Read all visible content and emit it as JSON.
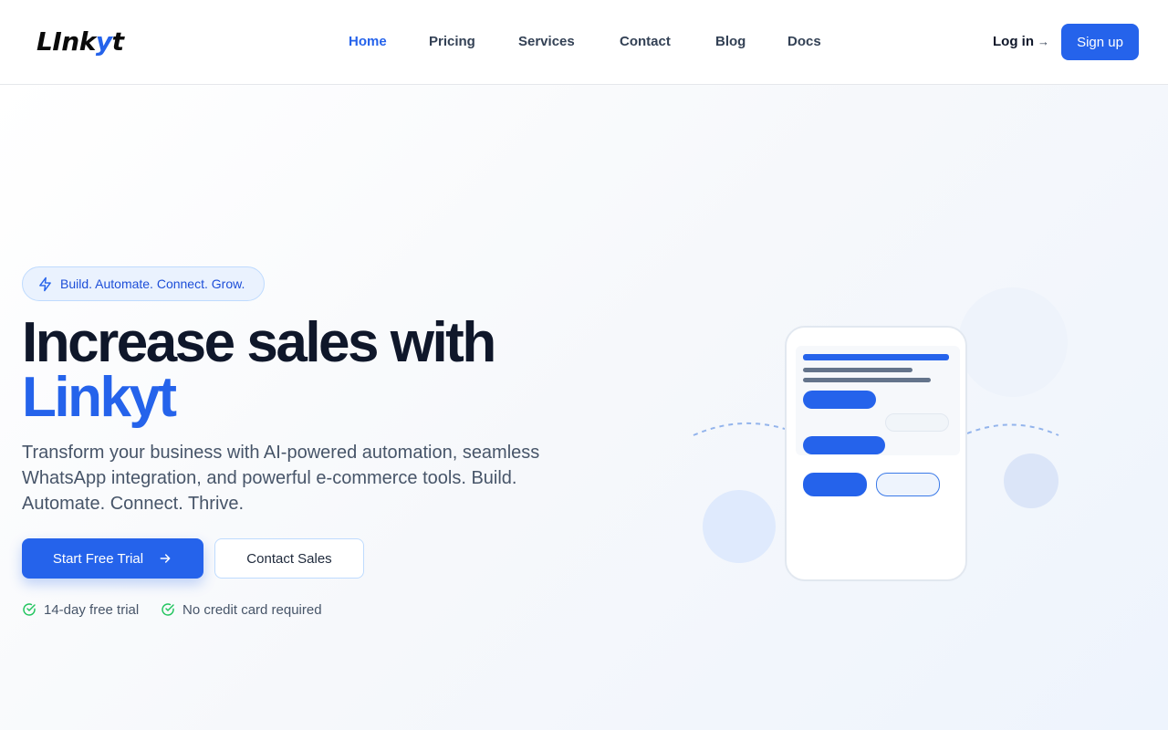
{
  "brand": {
    "logo_main": "LInk",
    "logo_accent": "y",
    "logo_end": "t",
    "accent_color": "#2563eb"
  },
  "nav": {
    "items": [
      {
        "label": "Home",
        "active": true
      },
      {
        "label": "Pricing",
        "active": false
      },
      {
        "label": "Services",
        "active": false
      },
      {
        "label": "Contact",
        "active": false
      },
      {
        "label": "Blog",
        "active": false
      },
      {
        "label": "Docs",
        "active": false
      }
    ],
    "login_label": "Log in",
    "login_arrow": "→",
    "signup_label": "Sign up"
  },
  "hero": {
    "badge": {
      "icon": "lightning-icon",
      "text": "Build. Automate. Connect. Grow."
    },
    "title_line1": "Increase sales with",
    "title_line2": "Linkyt",
    "subtitle": "Transform your business with AI-powered automation, seamless WhatsApp integration, and powerful e-commerce tools. Build. Automate. Connect. Thrive.",
    "primary_cta": "Start Free Trial",
    "secondary_cta": "Contact Sales",
    "checks": [
      {
        "icon": "check-circle-icon",
        "text": "14-day free trial"
      },
      {
        "icon": "check-circle-icon",
        "text": "No credit card required"
      }
    ]
  },
  "colors": {
    "check_green": "#22c55e",
    "primary": "#2563eb",
    "text_dark": "#0f172a"
  }
}
